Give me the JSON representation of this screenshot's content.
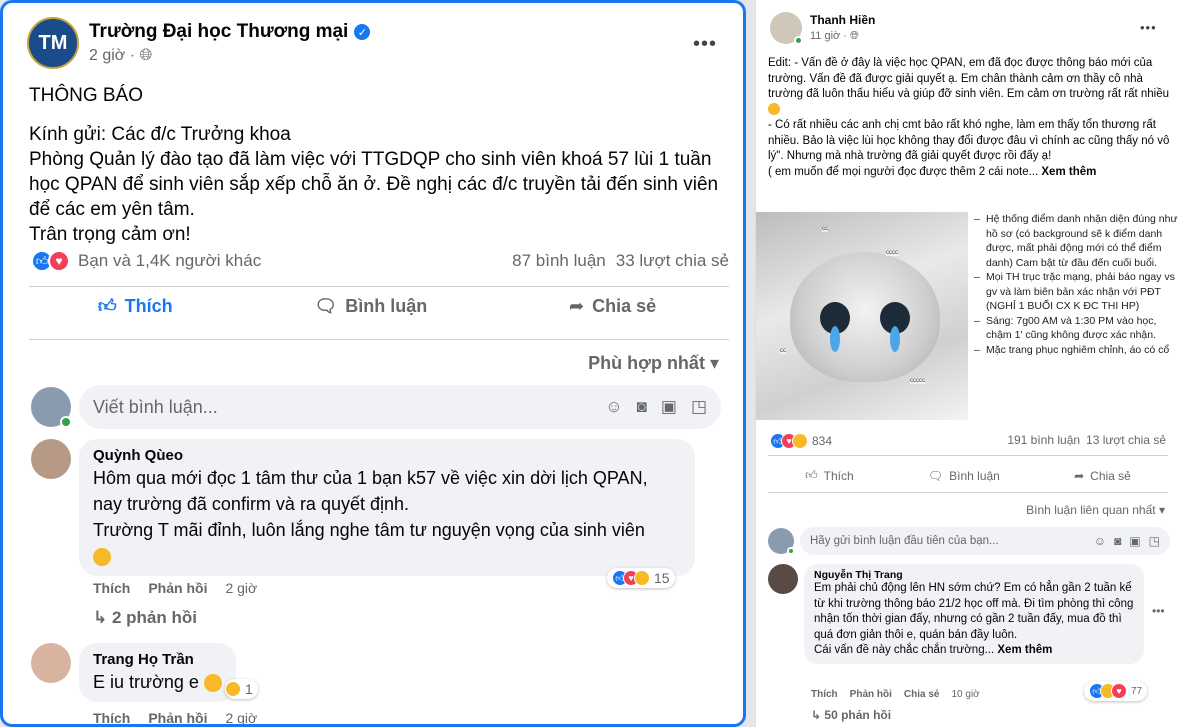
{
  "left_post": {
    "page_name": "Trường Đại học Thương mại",
    "avatar_text": "TM",
    "time": "2 giờ ·",
    "more": "•••",
    "body": {
      "heading": "THÔNG BÁO",
      "line1": "Kính gửi: Các đ/c Trưởng khoa",
      "line2": "Phòng Quản lý đào tạo đã làm việc với TTGDQP cho sinh viên khoá 57 lùi 1 tuần học QPAN để sinh viên sắp xếp chỗ ăn ở. Đề nghị các đ/c truyền tải đến sinh viên để các em yên tâm.",
      "line3": "Trân trọng cảm ơn!"
    },
    "reactions_text": "Bạn và 1,4K người khác",
    "comments_count": "87 bình luận",
    "shares_count": "33 lượt chia sẻ",
    "actions": {
      "like": "Thích",
      "comment": "Bình luận",
      "share": "Chia sẻ"
    },
    "sort_label": "Phù hợp nhất",
    "comment_placeholder": "Viết bình luận...",
    "comments": [
      {
        "author": "Quỳnh Qùeo",
        "text1": "Hôm qua mới đọc 1 tâm thư của 1 bạn k57 về việc xin dời lịch QPAN,",
        "text2": "nay trường đã confirm và ra quyết định.",
        "text3": "Trường T mãi đỉnh, luôn lắng nghe tâm tư nguyện vọng của sinh viên",
        "like": "Thích",
        "reply": "Phản hồi",
        "time": "2 giờ",
        "reaction_count": "15",
        "replies": "2 phản hồi"
      },
      {
        "author": "Trang Họ Trần",
        "text": "E iu trường e",
        "like": "Thích",
        "reply": "Phản hồi",
        "time": "2 giờ",
        "reaction_count": "1"
      }
    ]
  },
  "right_post": {
    "author": "Thanh Hiền",
    "time": "11 giờ ·",
    "more": "•••",
    "body": {
      "p1": "Edit: - Vấn đề ở đây là việc học QPAN, em đã đọc được thông báo mới của trường. Vấn đề đã được giải quyết ạ. Em chân thành cảm ơn thầy cô nhà trường đã luôn thấu hiểu và giúp đỡ sinh viên. Em cảm ơn trường rất rất nhiều",
      "p2": "- Có rất nhiều các anh chị cmt bảo rất khó nghe, làm em thấy tổn thương rất nhiều. Bảo là việc lùi học không thay đổi được đâu vì chính ac cũng thấy nó vô lý\". Nhưng mà nhà trường đã giải quyết được rồi đấy ạ!",
      "p3": "( em muốn để mọi người đọc được thêm 2 cái note...",
      "see_more": "Xem thêm"
    },
    "image_labels": [
      "cccc",
      "cc",
      "cc",
      "ccccc"
    ],
    "notes": [
      "Hệ thống điểm danh nhận diện đúng như hồ sơ (có background sẽ k điểm danh được, mất phải động mới có thể điểm danh) Cam bật từ đầu đến cuối buổi.",
      "Mọi TH trục trặc mạng, phải báo ngay vs gv và làm biên bản xác nhận với PĐT (NGHỈ 1 BUỔI CX K ĐC THI HP)",
      "Sáng: 7g00 AM và 1:30 PM vào học, chậm 1' cũng không được xác nhận.",
      "Mặc trang phục nghiêm chỉnh, áo có cổ"
    ],
    "reaction_count": "834",
    "comments_count": "191 bình luận",
    "shares_count": "13 lượt chia sẻ",
    "actions": {
      "like": "Thích",
      "comment": "Bình luận",
      "share": "Chia sẻ"
    },
    "sort_label": "Bình luận liên quan nhất",
    "comment_placeholder": "Hãy gửi bình luận đầu tiên của bạn...",
    "comment": {
      "author": "Nguyễn Thị Trang",
      "text": "Em phải chủ động lên HN sớm chứ? Em có hẳn gần 2 tuần kể từ khi trường thông báo 21/2 học off mà. Đi tìm phòng thì công nhận tốn thời gian đấy, nhưng có gần 2 tuần đấy, mua đồ thì quá đơn giản thôi e, quán bán đầy luôn.",
      "text2": "Cái vấn đề này chắc chắn trường...",
      "see_more": "Xem thêm",
      "like": "Thích",
      "reply": "Phản hồi",
      "share": "Chia sẻ",
      "time": "10 giờ",
      "reaction_count": "77",
      "replies": "50 phản hồi"
    }
  },
  "colors": {
    "accent": "#1877f2",
    "love": "#f33e58",
    "haha": "#f7b928",
    "muted": "#65676b"
  }
}
